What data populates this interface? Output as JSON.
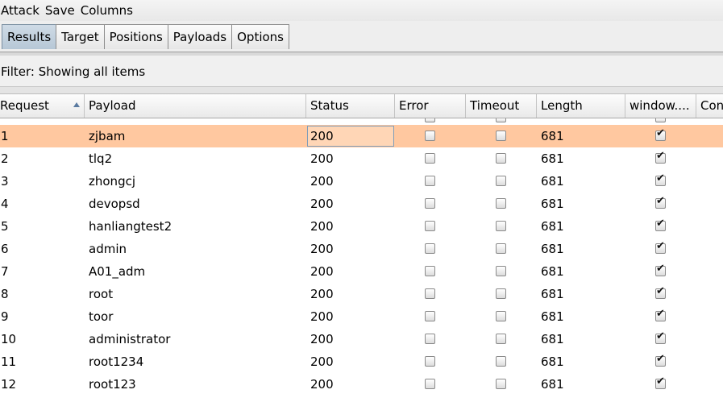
{
  "menu": [
    "Attack",
    "Save",
    "Columns"
  ],
  "tabs": [
    {
      "label": "Results",
      "active": true
    },
    {
      "label": "Target",
      "active": false
    },
    {
      "label": "Positions",
      "active": false
    },
    {
      "label": "Payloads",
      "active": false
    },
    {
      "label": "Options",
      "active": false
    }
  ],
  "filter": {
    "text": "Filter: Showing all items"
  },
  "columns": [
    "Request",
    "Payload",
    "Status",
    "Error",
    "Timeout",
    "Length",
    "window....",
    "Con"
  ],
  "rows": [
    {
      "request": "1",
      "payload": "zjbam",
      "status": "200",
      "error": false,
      "timeout": false,
      "length": "681",
      "window": true,
      "selected": true
    },
    {
      "request": "2",
      "payload": "tlq2",
      "status": "200",
      "error": false,
      "timeout": false,
      "length": "681",
      "window": true
    },
    {
      "request": "3",
      "payload": "zhongcj",
      "status": "200",
      "error": false,
      "timeout": false,
      "length": "681",
      "window": true
    },
    {
      "request": "4",
      "payload": "devopsd",
      "status": "200",
      "error": false,
      "timeout": false,
      "length": "681",
      "window": true
    },
    {
      "request": "5",
      "payload": "hanliangtest2",
      "status": "200",
      "error": false,
      "timeout": false,
      "length": "681",
      "window": true
    },
    {
      "request": "6",
      "payload": "admin",
      "status": "200",
      "error": false,
      "timeout": false,
      "length": "681",
      "window": true
    },
    {
      "request": "7",
      "payload": "A01_adm",
      "status": "200",
      "error": false,
      "timeout": false,
      "length": "681",
      "window": true
    },
    {
      "request": "8",
      "payload": "root",
      "status": "200",
      "error": false,
      "timeout": false,
      "length": "681",
      "window": true
    },
    {
      "request": "9",
      "payload": "toor",
      "status": "200",
      "error": false,
      "timeout": false,
      "length": "681",
      "window": true
    },
    {
      "request": "10",
      "payload": "administrator",
      "status": "200",
      "error": false,
      "timeout": false,
      "length": "681",
      "window": true
    },
    {
      "request": "11",
      "payload": "root1234",
      "status": "200",
      "error": false,
      "timeout": false,
      "length": "681",
      "window": true
    },
    {
      "request": "12",
      "payload": "root123",
      "status": "200",
      "error": false,
      "timeout": false,
      "length": "681",
      "window": true
    }
  ]
}
